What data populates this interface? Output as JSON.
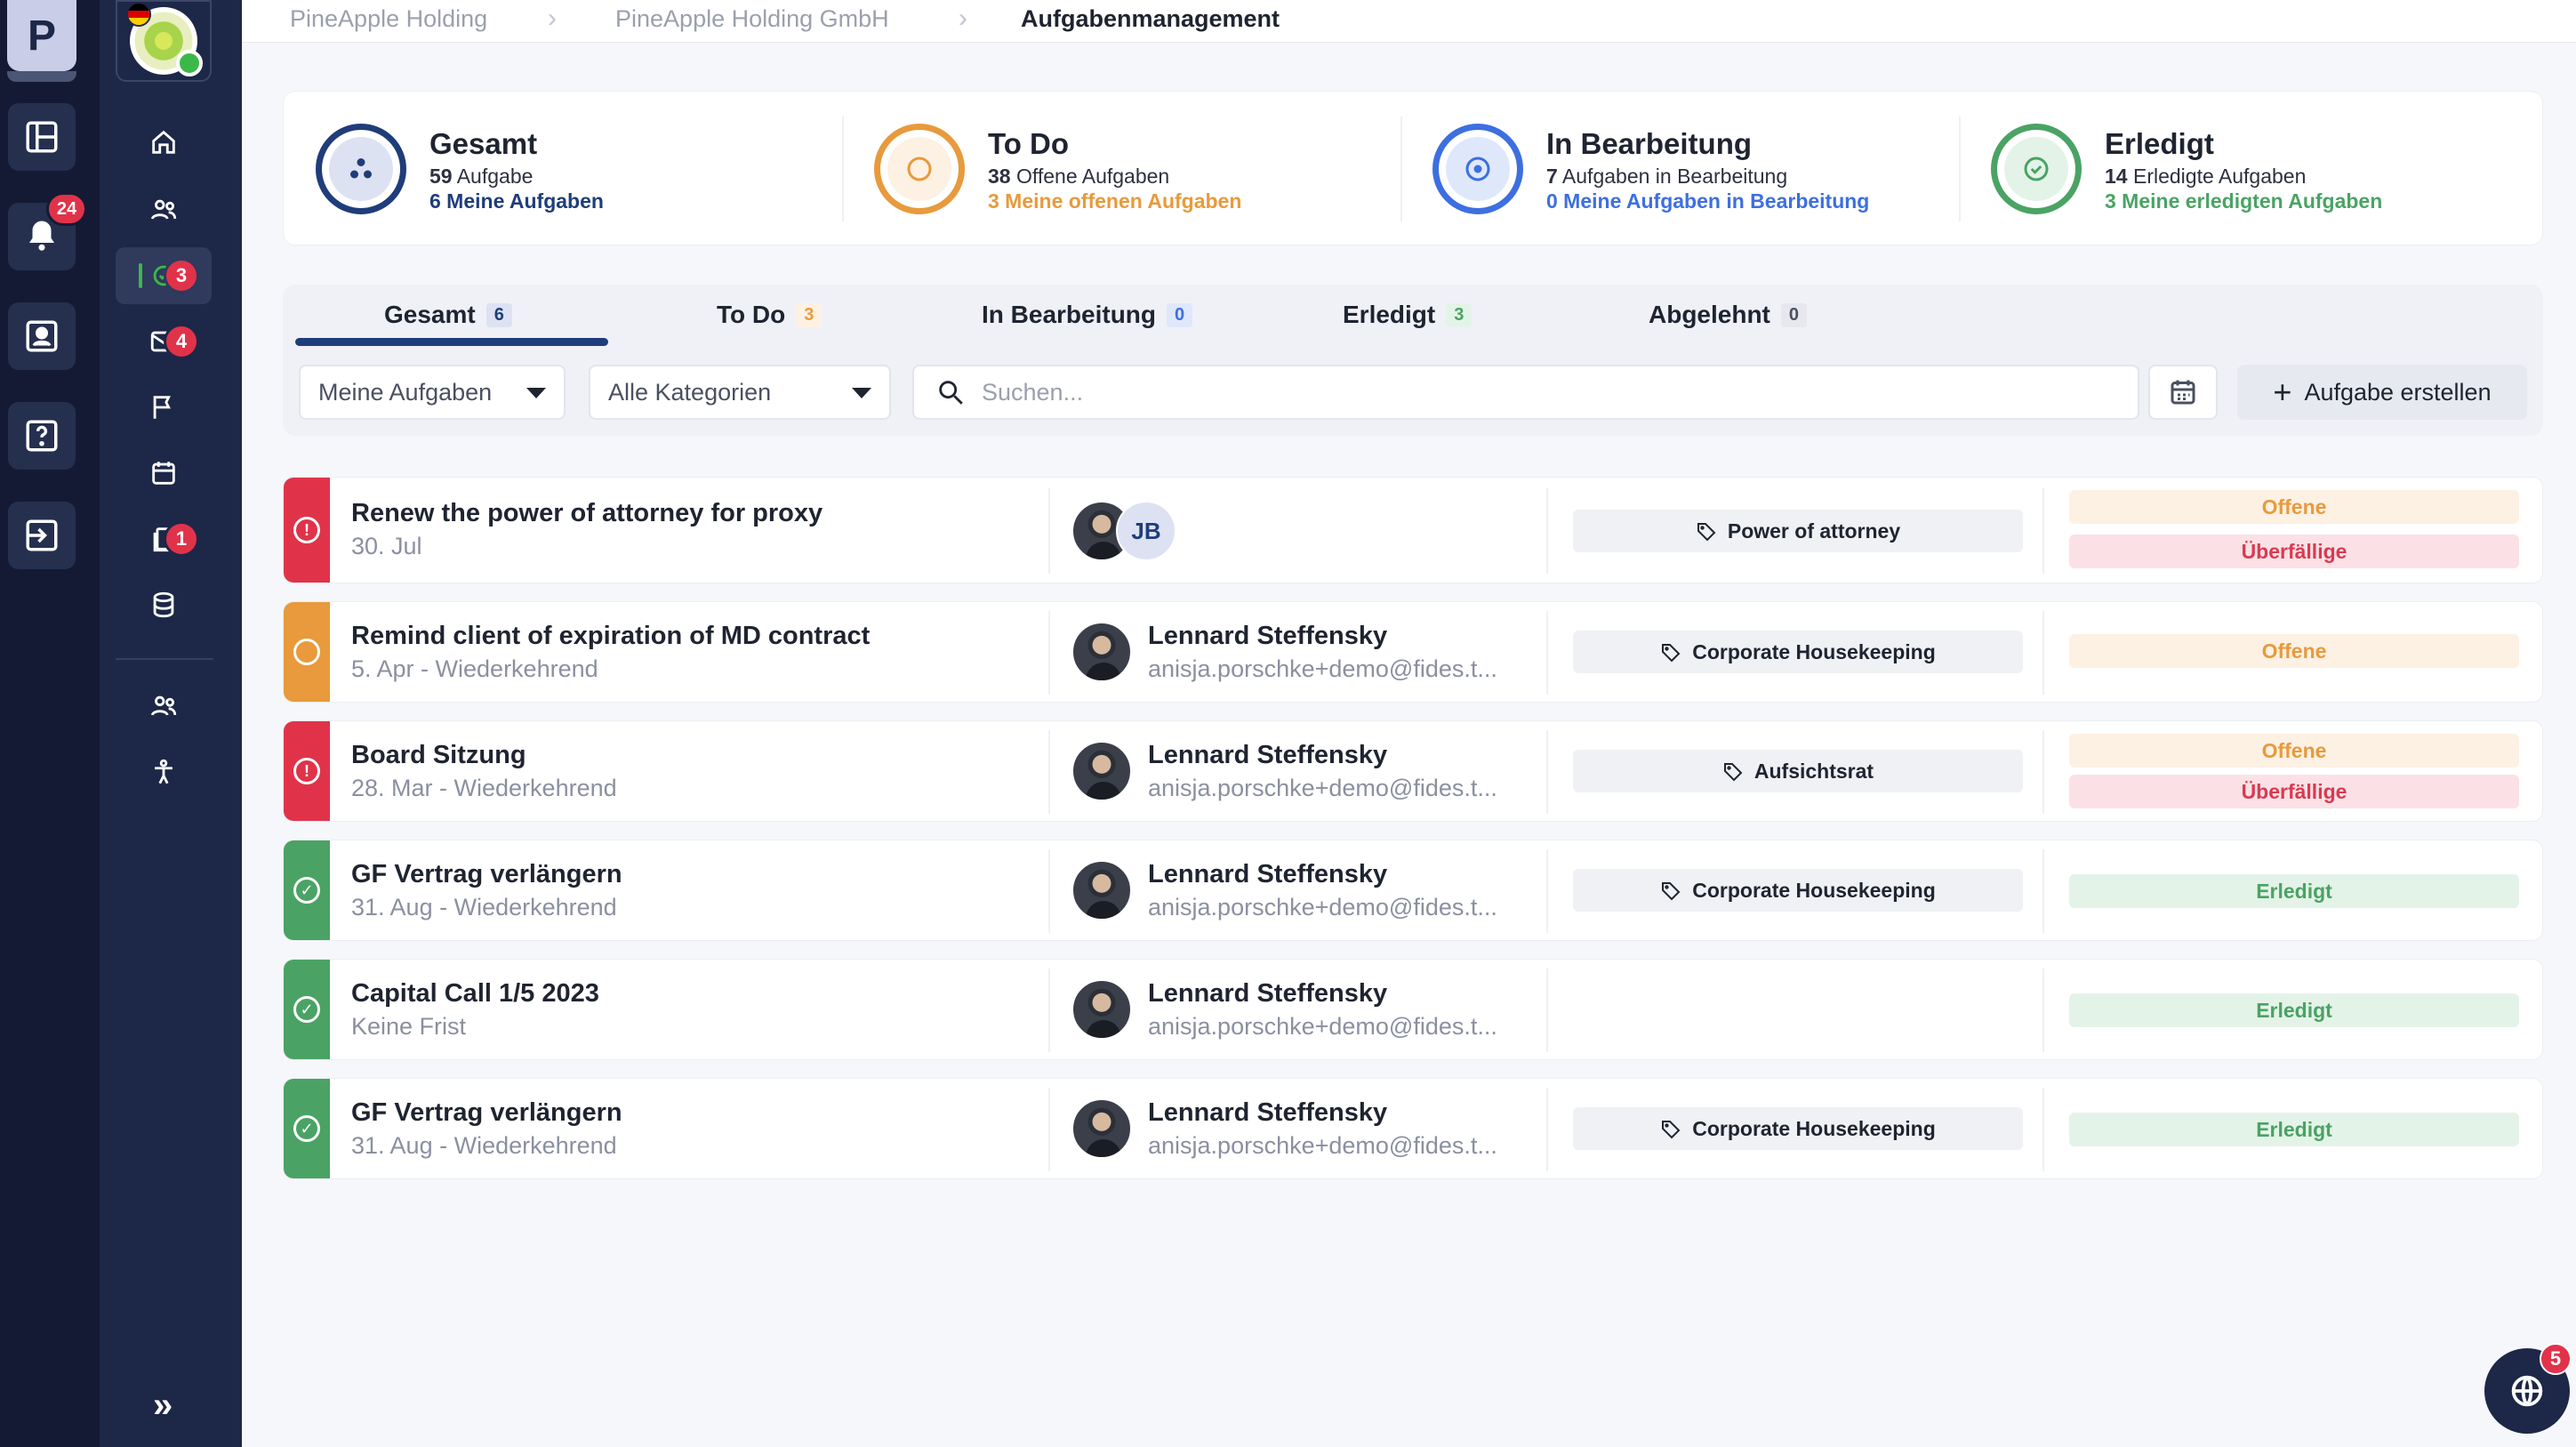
{
  "breadcrumb": [
    "PineApple Holding",
    "PineApple Holding GmbH",
    "Aufgabenmanagement"
  ],
  "rail": {
    "app_letter": "P",
    "notifications_count": "24",
    "tasks_badge": "3",
    "mail_badge": "4",
    "docs_badge": "1"
  },
  "stats": [
    {
      "title": "Gesamt",
      "count": "59",
      "count_label": "Aufgabe",
      "mine": "6 Meine Aufgaben",
      "color": "#1f3d7a"
    },
    {
      "title": "To Do",
      "count": "38",
      "count_label": "Offene Aufgaben",
      "mine": "3 Meine offenen Aufgaben",
      "color": "#e89a3c"
    },
    {
      "title": "In Bearbeitung",
      "count": "7",
      "count_label": "Aufgaben in Bearbeitung",
      "mine": "0 Meine Aufgaben in Bearbeitung",
      "color": "#3d6fe0"
    },
    {
      "title": "Erledigt",
      "count": "14",
      "count_label": "Erledigte Aufgaben",
      "mine": "3 Meine erledigten Aufgaben",
      "color": "#4aa364"
    }
  ],
  "tabs": [
    {
      "label": "Gesamt",
      "count": "6"
    },
    {
      "label": "To Do",
      "count": "3"
    },
    {
      "label": "In Bearbeitung",
      "count": "0"
    },
    {
      "label": "Erledigt",
      "count": "3"
    },
    {
      "label": "Abgelehnt",
      "count": "0"
    }
  ],
  "filters": {
    "assignee": "Meine Aufgaben",
    "category": "Alle Kategorien",
    "search_placeholder": "Suchen...",
    "create_label": "Aufgabe erstellen"
  },
  "tasks": [
    {
      "title": "Renew the power of attorney for proxy",
      "due": "30. Jul",
      "assignee_initials": "JB",
      "person": "",
      "email": "",
      "tag": "Power of attorney",
      "statuses": [
        "Offene",
        "Überfällige"
      ],
      "accent": "#e0334a"
    },
    {
      "title": "Remind client of expiration of MD contract",
      "due": "5. Apr - Wiederkehrend",
      "person": "Lennard Steffensky",
      "email": "anisja.porschke+demo@fides.t...",
      "tag": "Corporate Housekeeping",
      "statuses": [
        "Offene"
      ],
      "accent": "#e89a3c"
    },
    {
      "title": "Board Sitzung",
      "due": "28. Mar - Wiederkehrend",
      "person": "Lennard Steffensky",
      "email": "anisja.porschke+demo@fides.t...",
      "tag": "Aufsichtsrat",
      "statuses": [
        "Offene",
        "Überfällige"
      ],
      "accent": "#e0334a"
    },
    {
      "title": "GF Vertrag verlängern",
      "due": "31. Aug - Wiederkehrend",
      "person": "Lennard Steffensky",
      "email": "anisja.porschke+demo@fides.t...",
      "tag": "Corporate Housekeeping",
      "statuses": [
        "Erledigt"
      ],
      "accent": "#4aa364"
    },
    {
      "title": "Capital Call 1/5 2023",
      "due": "Keine Frist",
      "person": "Lennard Steffensky",
      "email": "anisja.porschke+demo@fides.t...",
      "tag": "",
      "statuses": [
        "Erledigt"
      ],
      "accent": "#4aa364"
    },
    {
      "title": "GF Vertrag verlängern",
      "due": "31. Aug - Wiederkehrend",
      "person": "Lennard Steffensky",
      "email": "anisja.porschke+demo@fides.t...",
      "tag": "Corporate Housekeeping",
      "statuses": [
        "Erledigt"
      ],
      "accent": "#4aa364"
    }
  ],
  "fab_badge": "5"
}
